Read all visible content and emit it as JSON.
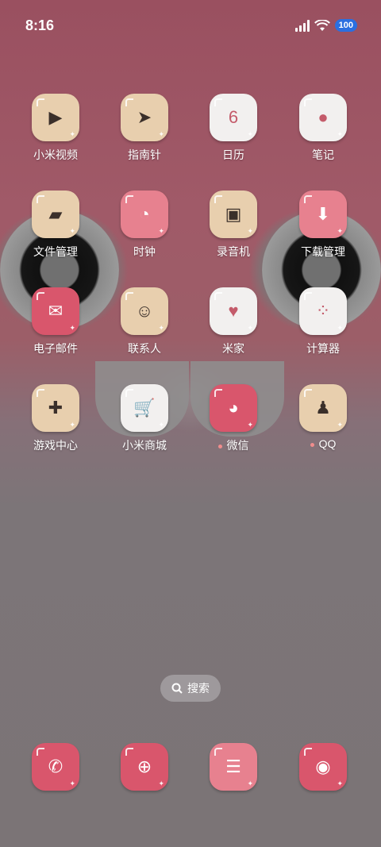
{
  "status": {
    "time": "8:16",
    "battery": "100"
  },
  "apps": [
    {
      "label": "小米视频",
      "icon": "video-icon",
      "tint": "beige",
      "glyph": "▶",
      "dot": false
    },
    {
      "label": "指南针",
      "icon": "compass-icon",
      "tint": "beige",
      "glyph": "➤",
      "dot": false
    },
    {
      "label": "日历",
      "icon": "calendar-icon",
      "tint": "white",
      "glyph": "6",
      "dot": false
    },
    {
      "label": "笔记",
      "icon": "notes-icon",
      "tint": "white",
      "glyph": "●",
      "dot": false
    },
    {
      "label": "文件管理",
      "icon": "folder-icon",
      "tint": "beige",
      "glyph": "▰",
      "dot": false
    },
    {
      "label": "时钟",
      "icon": "clock-icon",
      "tint": "pink",
      "glyph": "◔",
      "dot": false
    },
    {
      "label": "录音机",
      "icon": "recorder-icon",
      "tint": "beige",
      "glyph": "▣",
      "dot": false
    },
    {
      "label": "下载管理",
      "icon": "download-icon",
      "tint": "pink",
      "glyph": "⬇",
      "dot": false
    },
    {
      "label": "电子邮件",
      "icon": "mail-icon",
      "tint": "deeppink",
      "glyph": "✉",
      "dot": false
    },
    {
      "label": "联系人",
      "icon": "contacts-icon",
      "tint": "beige",
      "glyph": "☺",
      "dot": false
    },
    {
      "label": "米家",
      "icon": "mijia-icon",
      "tint": "white",
      "glyph": "♥",
      "dot": false
    },
    {
      "label": "计算器",
      "icon": "calculator-icon",
      "tint": "white",
      "glyph": "⁘",
      "dot": false
    },
    {
      "label": "游戏中心",
      "icon": "gamepad-icon",
      "tint": "beige",
      "glyph": "✚",
      "dot": false
    },
    {
      "label": "小米商城",
      "icon": "cart-icon",
      "tint": "white",
      "glyph": "🛒",
      "dot": false
    },
    {
      "label": "微信",
      "icon": "wechat-icon",
      "tint": "deeppink",
      "glyph": "◕",
      "dot": true
    },
    {
      "label": "QQ",
      "icon": "qq-icon",
      "tint": "beige",
      "glyph": "♟",
      "dot": true
    }
  ],
  "search": {
    "label": "搜索",
    "icon": "search-icon"
  },
  "dock": [
    {
      "icon": "phone-icon",
      "tint": "deeppink",
      "glyph": "✆"
    },
    {
      "icon": "browser-icon",
      "tint": "deeppink",
      "glyph": "⊕"
    },
    {
      "icon": "messages-icon",
      "tint": "pink",
      "glyph": "☰"
    },
    {
      "icon": "camera-icon",
      "tint": "deeppink",
      "glyph": "◉"
    }
  ]
}
